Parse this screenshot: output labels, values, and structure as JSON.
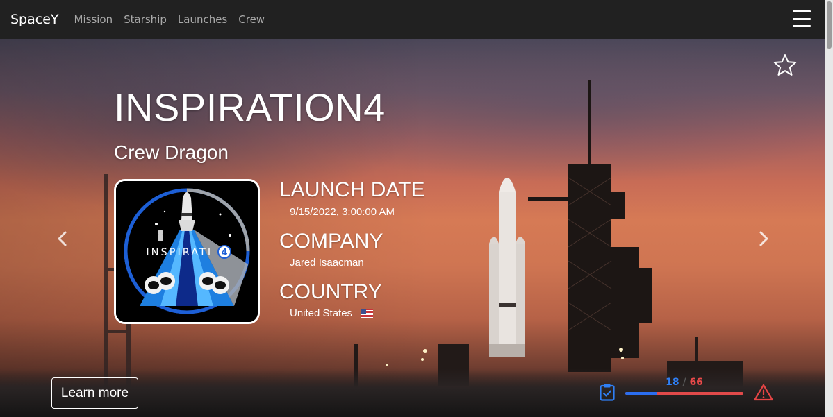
{
  "navbar": {
    "brand": "SpaceY",
    "links": [
      "Mission",
      "Starship",
      "Launches",
      "Crew"
    ],
    "menu_icon": "hamburger-menu-icon"
  },
  "hero": {
    "title": "INSPIRATION4",
    "subtitle": "Crew Dragon",
    "patch": {
      "text": "INSPIRATI N",
      "digit": "4"
    },
    "launch_date_label": "LAUNCH DATE",
    "launch_date_value": "9/15/2022, 3:00:00 AM",
    "company_label": "COMPANY",
    "company_value": "Jared Isaacman",
    "country_label": "COUNTRY",
    "country_value": "United States",
    "country_flag_icon": "us-flag-icon",
    "learn_more_label": "Learn more",
    "favorite_icon": "star-outline-icon",
    "prev_icon": "chevron-left-icon",
    "next_icon": "chevron-right-icon"
  },
  "status": {
    "completed": "18",
    "separator": "/",
    "total": "66",
    "progress_fraction": 0.27,
    "clipboard_icon": "clipboard-check-icon",
    "warning_icon": "warning-triangle-icon"
  },
  "colors": {
    "navbar_bg": "#212121",
    "progress_done": "#2b6ef0",
    "progress_remaining": "#e14a4a",
    "warning": "#e64545",
    "clipboard": "#2f7ff5"
  }
}
